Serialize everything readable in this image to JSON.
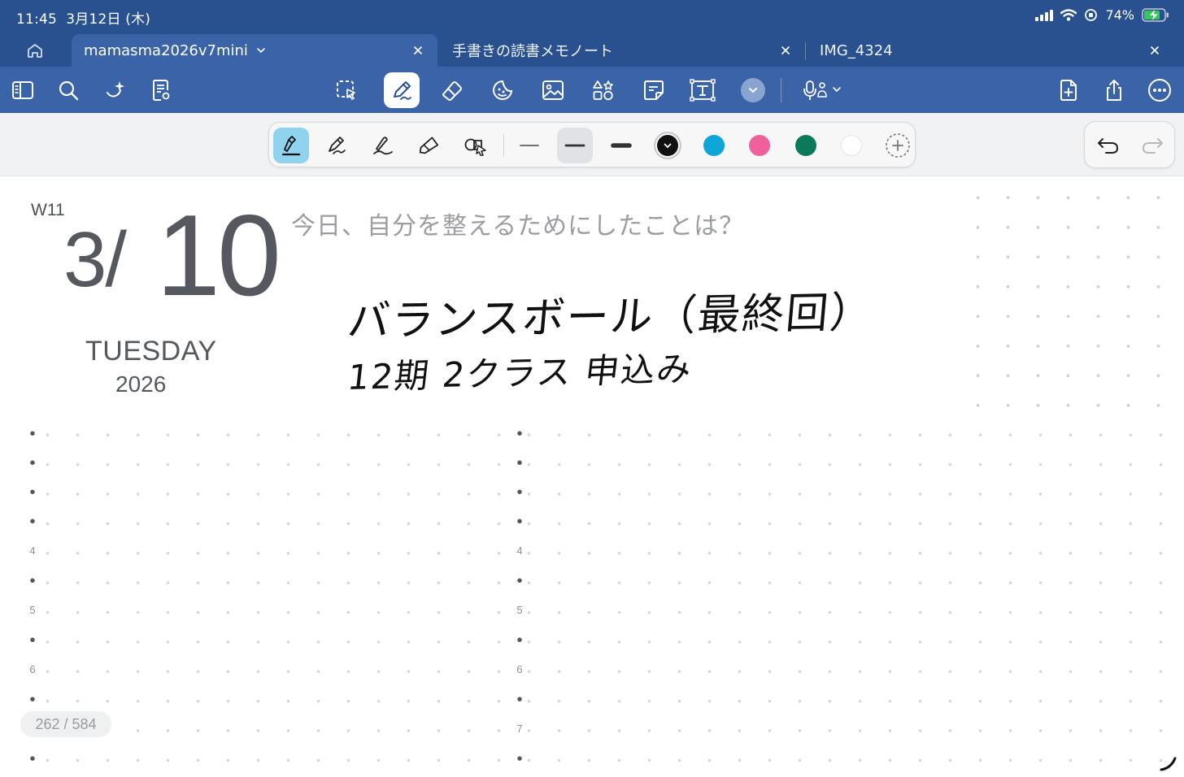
{
  "status": {
    "time": "11:45",
    "date": "3月12日 (木)",
    "battery": "74%"
  },
  "tabs": [
    {
      "label": "mamasma2026v7mini",
      "active": true
    },
    {
      "label": "手書きの読書メモノート",
      "active": false
    },
    {
      "label": "IMG_4324",
      "active": false
    }
  ],
  "toolbar": {
    "left_icons": [
      "sidebar-icon",
      "search-icon",
      "ai-sparkle-icon",
      "document-review-icon"
    ],
    "tools": [
      "lasso-icon",
      "pen-icon",
      "eraser-icon",
      "sticker-icon",
      "image-icon",
      "shapes-icon",
      "sticky-note-icon",
      "text-box-icon"
    ],
    "selected_tool": "pen-icon",
    "right_icons": [
      "add-page-icon",
      "share-icon",
      "more-icon"
    ]
  },
  "pen_bar": {
    "pen_types": [
      "fountain-pen-icon",
      "ballpoint-pen-icon",
      "brush-pen-icon",
      "highlighter-icon",
      "shape-pen-icon"
    ],
    "selected_pen": "fountain-pen-icon",
    "thickness_levels": [
      "thin",
      "medium",
      "thick"
    ],
    "selected_thickness": "medium",
    "colors": [
      "#111111",
      "#0ea5d9",
      "#f0609a",
      "#0b7a5a",
      "#ffffff"
    ],
    "selected_color": "#111111"
  },
  "planner": {
    "week": "W11",
    "month": "3/",
    "day": "10",
    "weekday": "TUESDAY",
    "year": "2026",
    "prompt": "今日、自分を整えるためにしたことは？"
  },
  "handwriting": {
    "line1": "バランスボール（最終回）",
    "line2": "12期 2クラス 申込み"
  },
  "grid_labels": {
    "left": [
      "4",
      "5",
      "6"
    ],
    "middle": [
      "4",
      "5",
      "6",
      "7"
    ]
  },
  "page_counter": "262 / 584"
}
